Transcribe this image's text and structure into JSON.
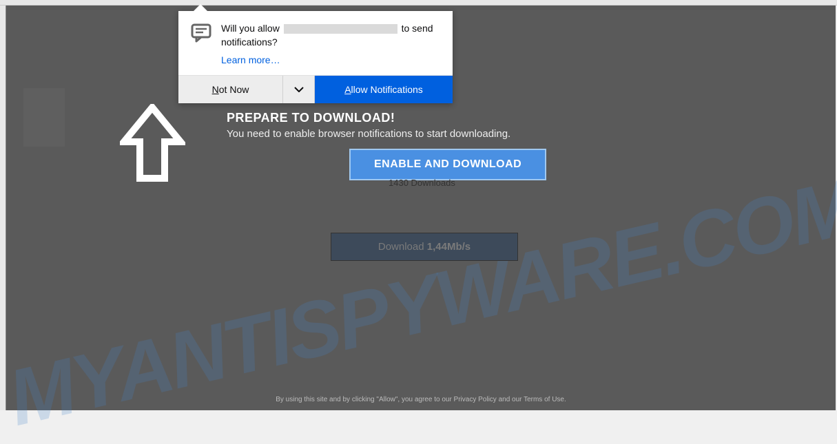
{
  "popup": {
    "message_prefix": "Will you allow",
    "message_suffix": "to send notifications?",
    "learn_more": "Learn more…",
    "not_now_prefix": "N",
    "not_now_suffix": "ot Now",
    "allow_prefix": "A",
    "allow_suffix": "llow Notifications"
  },
  "content": {
    "headline": "PREPARE TO DOWNLOAD!",
    "subline": "You need to enable browser notifications to start downloading.",
    "enable_button": "ENABLE AND DOWNLOAD",
    "downloads_count": "1430 Downloads",
    "download_label": "Download ",
    "download_speed": "1,44Mb/s"
  },
  "footer": {
    "text": "By using this site and by clicking \"Allow\", you agree to our Privacy Policy and our Terms of Use."
  },
  "watermark": "MYANTISPYWARE.COM"
}
